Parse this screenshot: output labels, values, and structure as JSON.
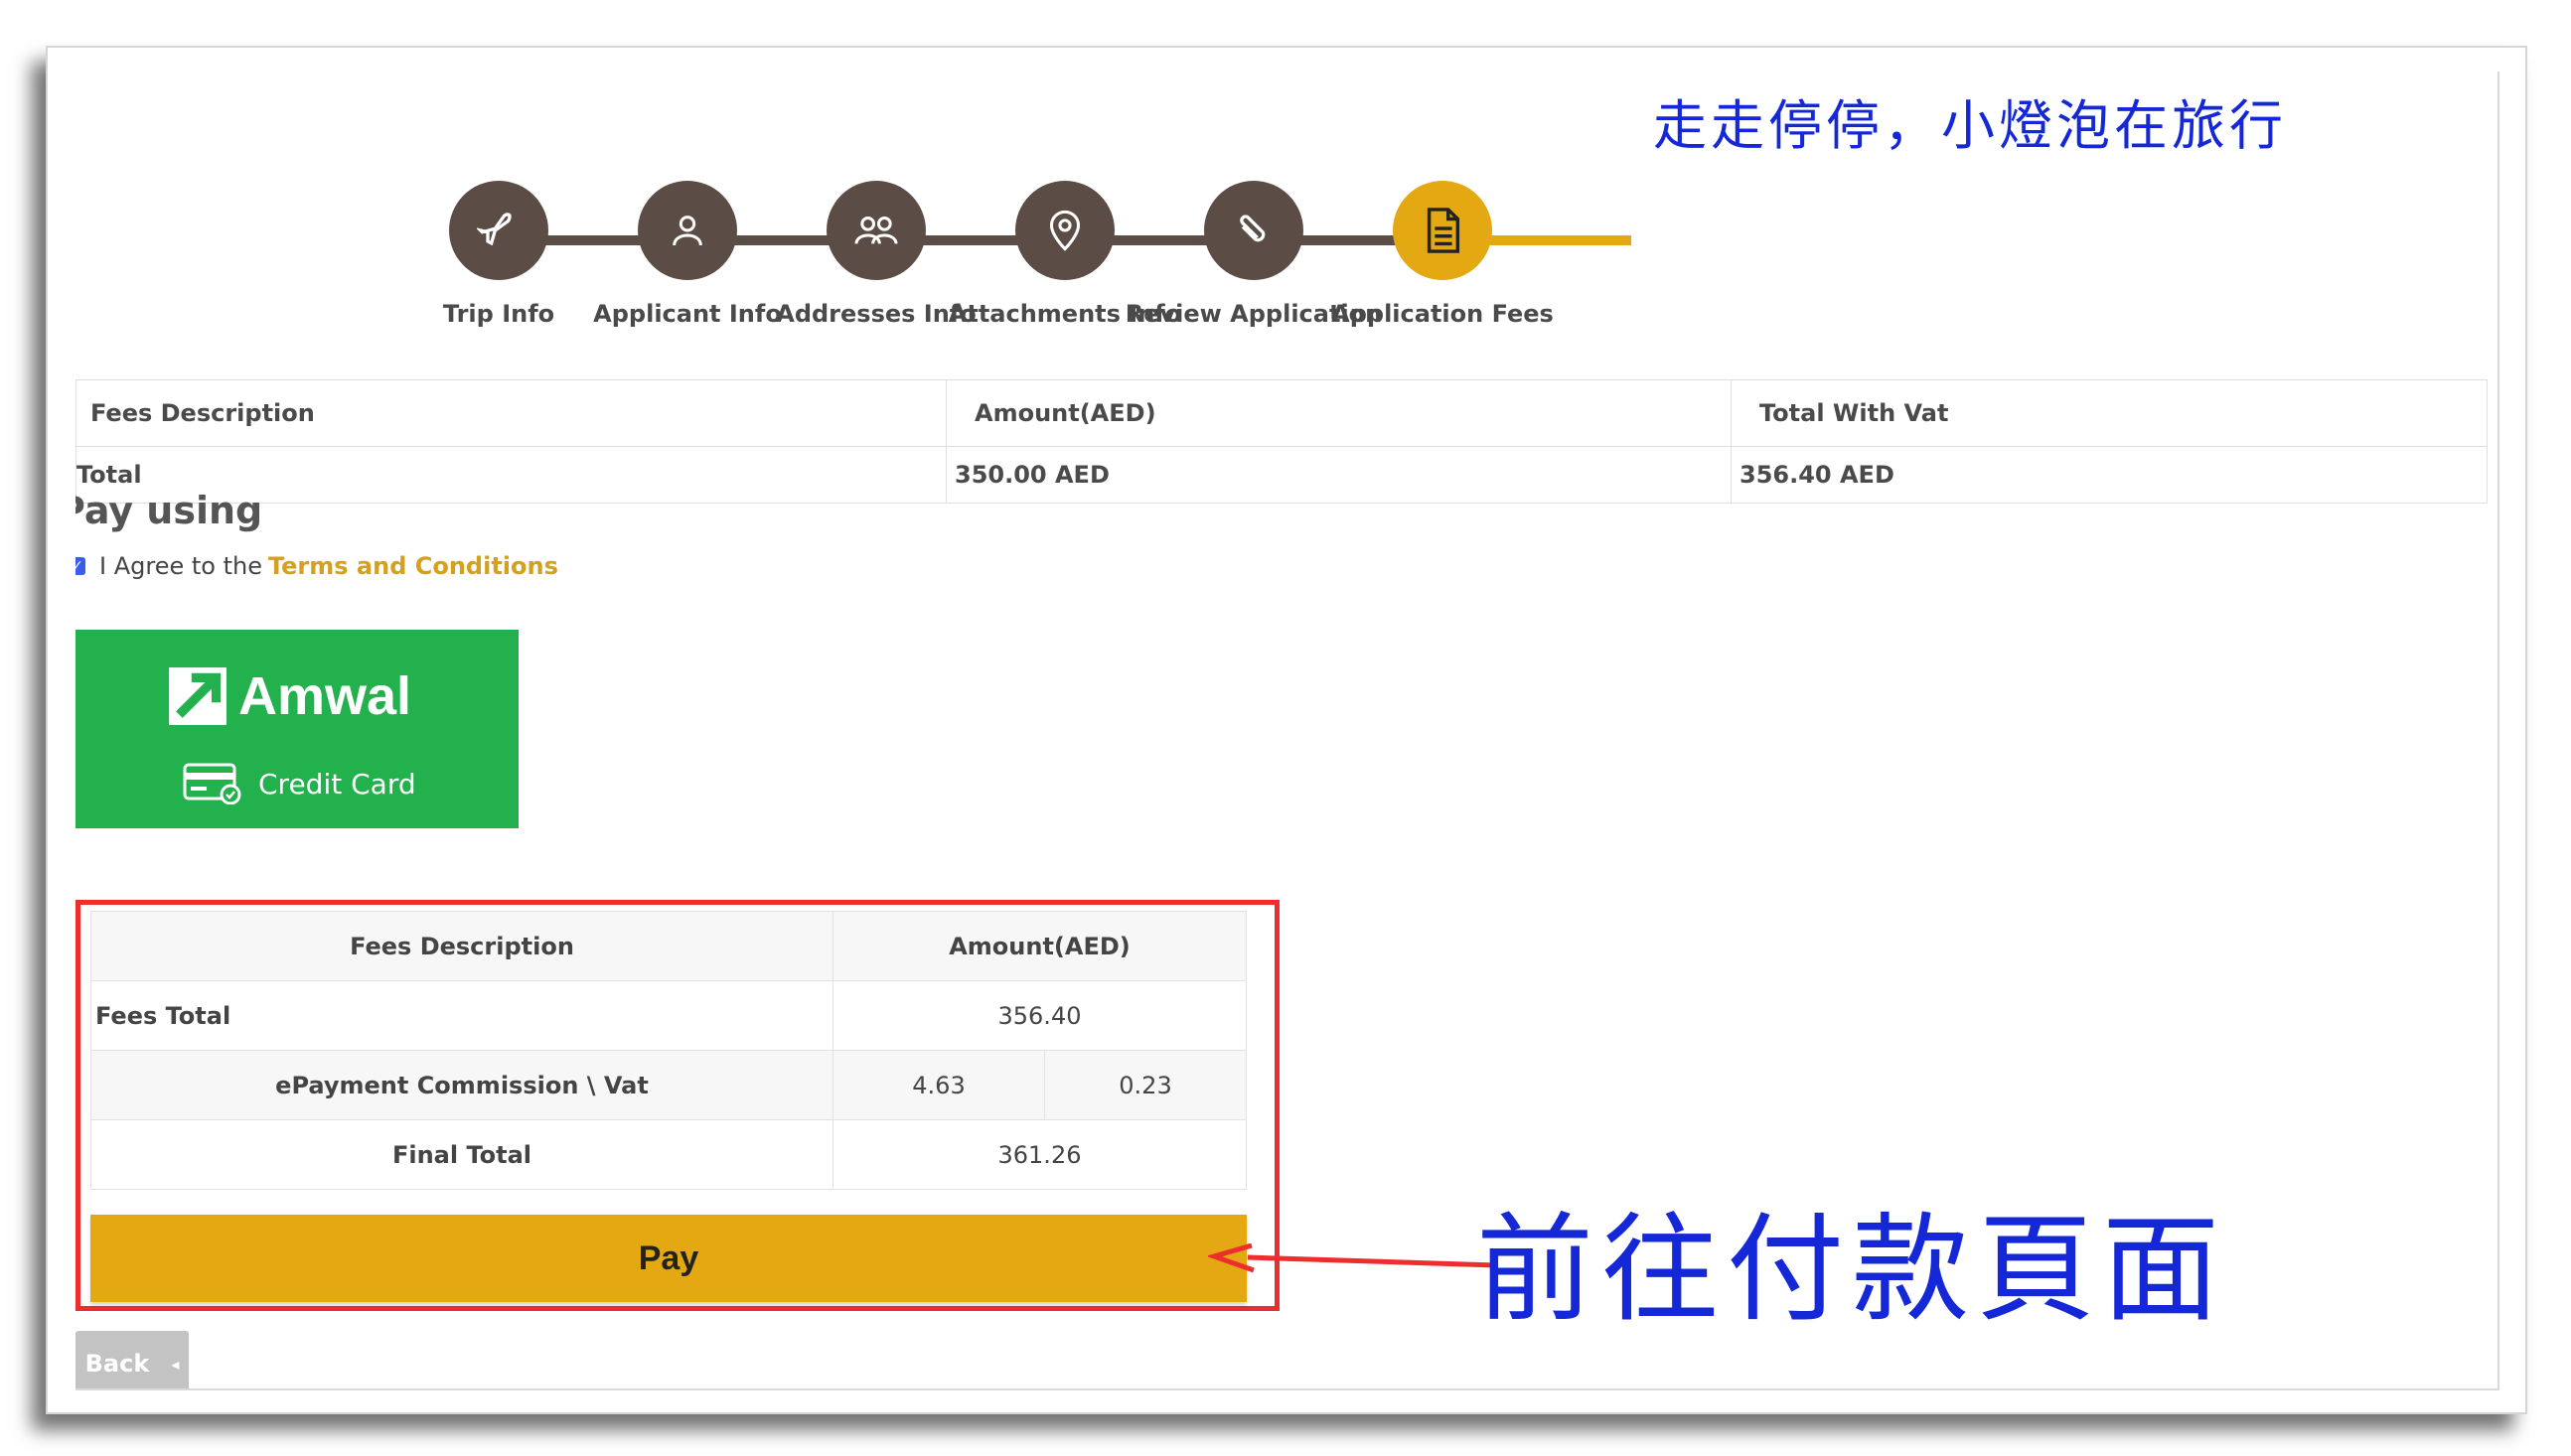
{
  "watermark": "走走停停，小燈泡在旅行",
  "stepper": {
    "steps": [
      {
        "label": "Trip Info",
        "icon": "airplane-icon"
      },
      {
        "label": "Applicant Info",
        "icon": "user-icon"
      },
      {
        "label": "Addresses Info",
        "icon": "users-icon"
      },
      {
        "label": "Attachments Info",
        "icon": "location-pin-icon"
      },
      {
        "label": "Review Application",
        "icon": "paperclip-icon"
      },
      {
        "label": "Application Fees",
        "icon": "document-icon"
      }
    ],
    "active_step": "Application Fees"
  },
  "fees_summary": {
    "headers": [
      "Fees Description",
      "Amount(AED)",
      "Total With Vat"
    ],
    "rows": [
      [
        "Total",
        "350.00 AED",
        "356.40 AED"
      ]
    ]
  },
  "payment": {
    "heading": "Pay using",
    "agree_prefix": "I Agree to the",
    "terms_link": "Terms and Conditions",
    "agree_checked": true,
    "provider_name": "Amwal",
    "provider_method": "Credit Card"
  },
  "breakdown": {
    "header_desc": "Fees Description",
    "header_amount": "Amount(AED)",
    "fees_total_label": "Fees Total",
    "fees_total_value": "356.40",
    "commission_label": "ePayment Commission \\ Vat",
    "commission_value": "4.63",
    "vat_value": "0.23",
    "final_total_label": "Final Total",
    "final_total_value": "361.26"
  },
  "actions": {
    "pay": "Pay",
    "back": "Back"
  },
  "annotation": "前往付款頁面",
  "colors": {
    "step_dark": "#5b4d45",
    "accent": "#e4a812",
    "amwal_green": "#22b14c",
    "highlight_red": "#ee2e2e",
    "annotation_blue": "#1528d8"
  }
}
